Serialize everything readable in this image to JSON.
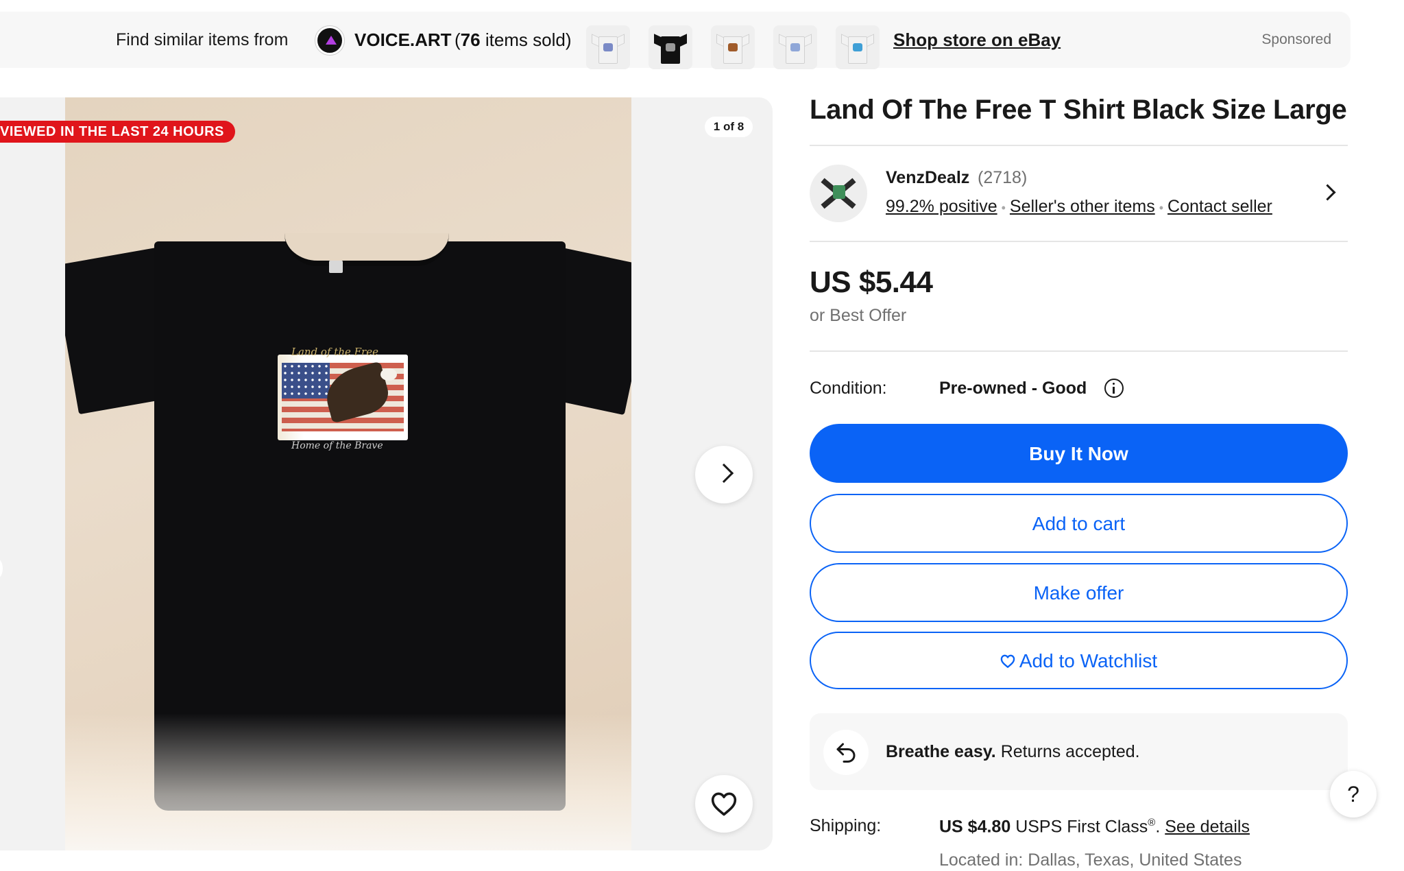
{
  "banner": {
    "prefix": "Find similar items from",
    "store_name": "VOICE.ART",
    "store_sold_open": "(",
    "store_sold_count": "76",
    "store_sold_rest": " items sold)",
    "shop_link": "Shop store on eBay",
    "sponsored": "Sponsored",
    "thumbnails": [
      {
        "shirt_color": "#f2f2f2",
        "mark_color": "#7a8ac6"
      },
      {
        "shirt_color": "#111111",
        "mark_color": "#9a9a9a"
      },
      {
        "shirt_color": "#f2f2f2",
        "mark_color": "#a05b2a"
      },
      {
        "shirt_color": "#f2f2f2",
        "mark_color": "#8fa7d8"
      },
      {
        "shirt_color": "#f2f2f2",
        "mark_color": "#3f9fd6"
      }
    ]
  },
  "gallery": {
    "badge": "VIEWED IN THE LAST 24 HOURS",
    "counter": "1 of 8",
    "graphic_top_text": "Land of the Free",
    "graphic_bottom_text": "Home of the Brave"
  },
  "listing": {
    "title": "Land Of The Free T Shirt Black Size Large",
    "seller": {
      "name": "VenzDealz",
      "feedback_count": "(2718)",
      "positive": "99.2% positive",
      "other_items": "Seller's other items",
      "contact": "Contact seller"
    },
    "price": "US $5.44",
    "best_offer": "or Best Offer",
    "condition_label": "Condition:",
    "condition_value": "Pre-owned - Good",
    "buttons": {
      "buy_now": "Buy It Now",
      "add_to_cart": "Add to cart",
      "make_offer": "Make offer",
      "watchlist": "Add to Watchlist"
    },
    "returns": {
      "bold": "Breathe easy.",
      "text": " Returns accepted."
    },
    "shipping": {
      "label": "Shipping:",
      "price": "US $4.80",
      "service": " USPS First Class",
      "registered": "®",
      "sep": ". ",
      "details_link": "See details",
      "location": "Located in: Dallas, Texas, United States"
    }
  },
  "help": {
    "label": "?"
  },
  "colors": {
    "accent_blue": "#0a63f6",
    "badge_red": "#e0151b",
    "text": "#191919",
    "muted": "#707070"
  }
}
